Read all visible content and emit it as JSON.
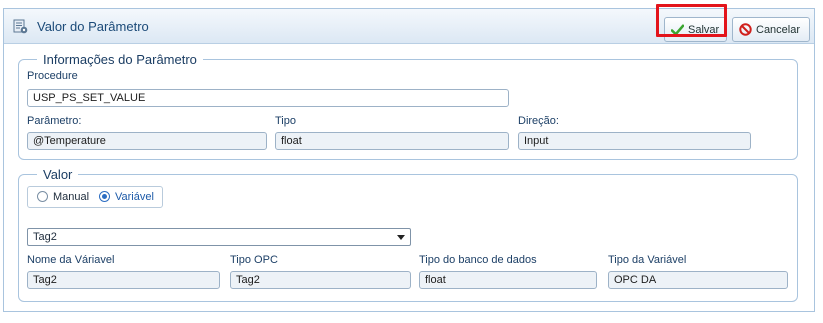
{
  "dialog": {
    "title": "Valor do Parâmetro",
    "save_label": "Salvar",
    "cancel_label": "Cancelar"
  },
  "params_section": {
    "legend": "Informações do Parâmetro",
    "procedure_label": "Procedure",
    "procedure_value": "USP_PS_SET_VALUE",
    "parameter_label": "Parâmetro:",
    "parameter_value": "@Temperature",
    "type_label": "Tipo",
    "type_value": "float",
    "direction_label": "Direção:",
    "direction_value": "Input"
  },
  "value_section": {
    "legend": "Valor",
    "radio_manual": "Manual",
    "radio_variable": "Variável",
    "selected_radio": "Variável",
    "tag_select_value": "Tag2",
    "variable_name_label": "Nome da Váriavel",
    "variable_name_value": "Tag2",
    "opc_type_label": "Tipo OPC",
    "opc_type_value": "Tag2",
    "db_type_label": "Tipo do banco de dados",
    "db_type_value": "float",
    "variable_type_label": "Tipo da Variável",
    "variable_type_value": "OPC DA"
  },
  "colors": {
    "accent": "#1b4a78",
    "highlight": "#e3141b",
    "save_icon": "#3aa52f",
    "cancel_icon": "#d0201c"
  },
  "icons": {
    "title": "parameter-dialog-icon",
    "save": "checkmark-icon",
    "cancel": "no-entry-icon"
  }
}
